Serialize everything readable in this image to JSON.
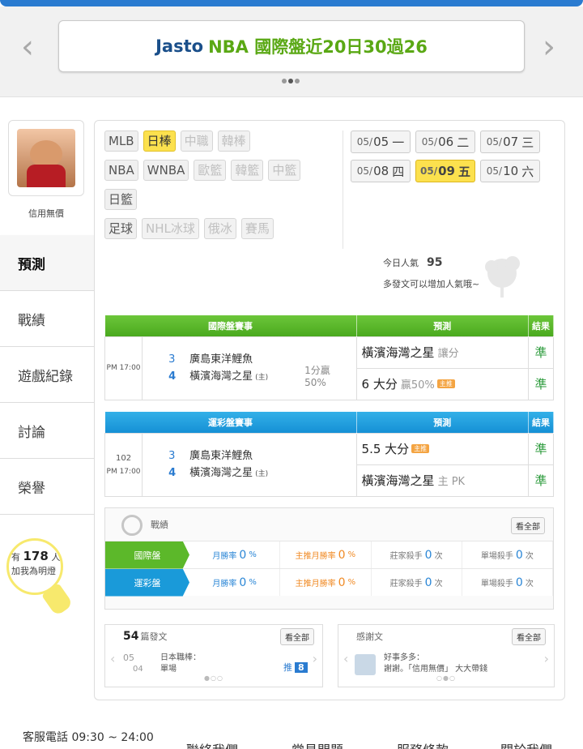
{
  "banner": {
    "title_prefix": "Jasto",
    "title_main": "NBA 國際盤近20日30過26",
    "prev_icon": "chevron-left-icon",
    "next_icon": "chevron-right-icon"
  },
  "profile": {
    "name": "信用無價"
  },
  "sidebar": {
    "items": [
      {
        "label": "預測"
      },
      {
        "label": "戰績"
      },
      {
        "label": "遊戲紀錄"
      },
      {
        "label": "討論"
      },
      {
        "label": "榮譽"
      }
    ]
  },
  "fans": {
    "prefix": "有",
    "count": "178",
    "unit": "人",
    "line2": "加我為明燈"
  },
  "categories": {
    "row1": [
      "MLB",
      "日棒",
      "中職",
      "韓棒"
    ],
    "row2": [
      "NBA",
      "WNBA",
      "歐籃",
      "韓籃",
      "中籃"
    ],
    "row3": [
      "日籃"
    ],
    "row4": [
      "足球",
      "NHL冰球",
      "俄冰",
      "賽馬"
    ],
    "selected": "日棒"
  },
  "dates": [
    {
      "md": "05/",
      "d": "05",
      "w": "一"
    },
    {
      "md": "05/",
      "d": "06",
      "w": "二"
    },
    {
      "md": "05/",
      "d": "07",
      "w": "三"
    },
    {
      "md": "05/",
      "d": "08",
      "w": "四"
    },
    {
      "md": "05/",
      "d": "09",
      "w": "五"
    },
    {
      "md": "05/",
      "d": "10",
      "w": "六"
    }
  ],
  "popularity": {
    "label": "今日人氣",
    "value": "95",
    "hint": "多發文可以增加人氣哦~"
  },
  "intl_table": {
    "headers": [
      "國際盤賽事",
      "預測",
      "結果"
    ],
    "time": "PM 17:00",
    "away_num": "3",
    "away_team": "廣島東洋鯉魚",
    "home_num": "4",
    "home_team": "橫濱海灣之星",
    "home_mark": "(主)",
    "odds1": "1分贏",
    "odds2": "50%",
    "pred1_main": "橫濱海灣之星",
    "pred1_sub": "讓分",
    "pred2_main": "6 大分",
    "pred2_sub": "贏50%",
    "pred2_tag": "主推",
    "result1": "準",
    "result2": "準"
  },
  "lottery_table": {
    "headers": [
      "運彩盤賽事",
      "預測",
      "結果"
    ],
    "game_no": "102",
    "time": "PM 17:00",
    "away_num": "3",
    "away_team": "廣島東洋鯉魚",
    "home_num": "4",
    "home_team": "橫濱海灣之星",
    "home_mark": "(主)",
    "pred1_main": "5.5 大分",
    "pred1_tag": "主推",
    "pred2_main": "橫濱海灣之星",
    "pred2_sub": "主 PK",
    "result1": "準",
    "result2": "準"
  },
  "record": {
    "title": "戰績",
    "view_all": "看全部",
    "rows": [
      {
        "label": "國際盤",
        "month_rate_label": "月勝率",
        "month_rate": "0",
        "main_rate_label": "主推月勝率",
        "main_rate": "0",
        "banker_label": "莊家殺手",
        "banker": "0",
        "single_label": "單場殺手",
        "single": "0"
      },
      {
        "label": "運彩盤",
        "month_rate_label": "月勝率",
        "month_rate": "0",
        "main_rate_label": "主推月勝率",
        "main_rate": "0",
        "banker_label": "莊家殺手",
        "banker": "0",
        "single_label": "單場殺手",
        "single": "0"
      }
    ],
    "pct": "%",
    "times": "次"
  },
  "posts": {
    "count": "54",
    "label": "篇發文",
    "view_all": "看全部",
    "date_top": "05",
    "date_bottom": "04",
    "item_title": "日本職棒：",
    "item_sub": "單場",
    "push_label": "推",
    "push_count": "8"
  },
  "thanks": {
    "label": "感謝文",
    "view_all": "看全部",
    "item_title": "好事多多：",
    "item_sub": "謝謝。「信用無價」 大大帶錢"
  },
  "footer": {
    "phone": "客服電話 09:30 ~ 24:00",
    "links": [
      "聯絡我們",
      "常見問題",
      "服務條款",
      "關於我們"
    ]
  }
}
